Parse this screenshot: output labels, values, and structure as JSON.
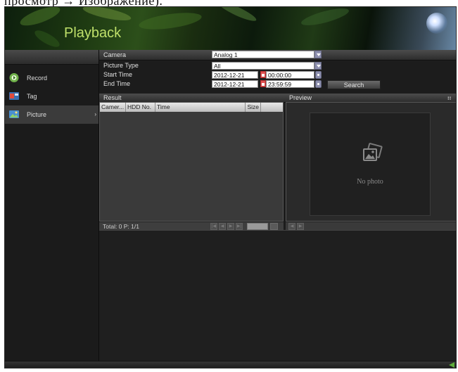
{
  "caption": "просмотр → Изображение).",
  "header": {
    "title": "Playback"
  },
  "sidebar": {
    "items": [
      {
        "label": "Record",
        "icon": "record-icon"
      },
      {
        "label": "Tag",
        "icon": "tag-icon"
      },
      {
        "label": "Picture",
        "icon": "picture-icon",
        "active": true,
        "arrow": "›"
      }
    ]
  },
  "filters": {
    "camera_label": "Camera",
    "camera_value": "Analog 1",
    "picture_type_label": "Picture Type",
    "picture_type_value": "All",
    "start_time_label": "Start Time",
    "start_date": "2012-12-21",
    "start_time": "00:00:00",
    "end_time_label": "End Time",
    "end_date": "2012-12-21",
    "end_time": "23:59:59",
    "search_label": "Search"
  },
  "result": {
    "title": "Result",
    "columns": [
      "Camer...",
      "HDD No.",
      "Time",
      "Size"
    ],
    "pager_text": "Total: 0  P: 1/1"
  },
  "preview": {
    "title": "Preview",
    "no_photo": "No photo"
  },
  "colors": {
    "accent": "#bfe06a",
    "dropdown": "#8d8fae",
    "calendar": "#e05050"
  }
}
